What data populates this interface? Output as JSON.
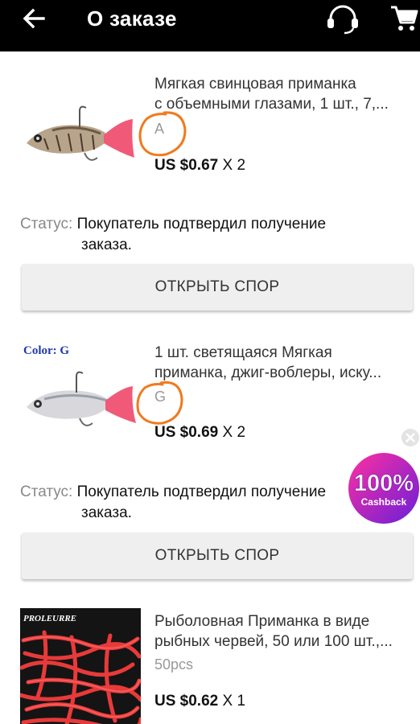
{
  "header": {
    "title": "О заказе"
  },
  "orders": [
    {
      "title_line1": "Мягкая свинцовая приманка",
      "title_line2": "с объемными глазами, 1 шт., 7,...",
      "variant": "A",
      "price": "US $0.67",
      "qty": "X 2",
      "status_label": "Статус:",
      "status_line1": "Покупатель подтвердил получение",
      "status_line2": "заказа.",
      "button": "ОТКРЫТЬ СПОР"
    },
    {
      "image_label": "Color: G",
      "title_line1": "1 шт. светящаяся Мягкая",
      "title_line2": "приманка, джиг-воблеры, иску...",
      "variant": "G",
      "price": "US $0.69",
      "qty": "X 2",
      "status_label": "Статус:",
      "status_line1": "Покупатель подтвердил получение",
      "status_line2": "заказа.",
      "button": "ОТКРЫТЬ СПОР"
    },
    {
      "image_label": "PROLEURRE",
      "title_line1": "Рыболовная Приманка в виде",
      "title_line2": "рыбных червей, 50 или 100 шт.,...",
      "variant": "50pcs",
      "price": "US $0.62",
      "qty": "X 1"
    }
  ],
  "cashback": {
    "big": "100%",
    "small": "Cashback"
  },
  "icons": [
    "back-arrow-icon",
    "support-headset-icon",
    "cart-icon",
    "close-icon"
  ],
  "colors": {
    "topbar": "#000000",
    "annotation": "#f07a1e",
    "button_bg": "#efefef",
    "cashback_start": "#ff2fa0",
    "cashback_end": "#6a1fd9"
  }
}
